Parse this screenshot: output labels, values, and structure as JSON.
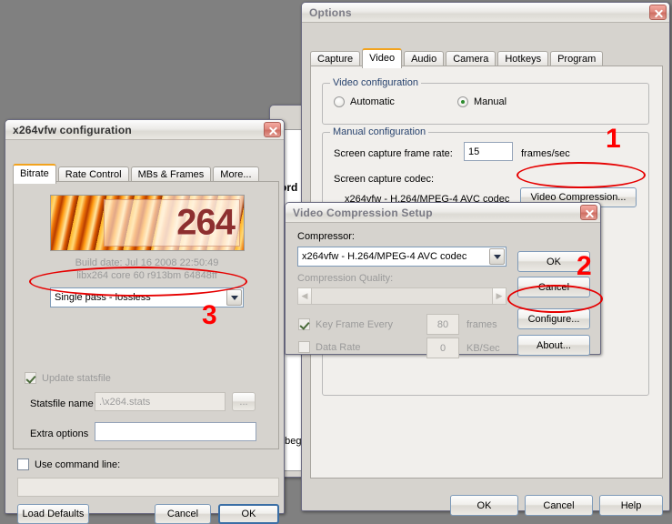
{
  "desktop": {
    "background_color": "#808080"
  },
  "background_window": {
    "fragment_top": "ord",
    "fragment_bottom": "o beg"
  },
  "options_dialog": {
    "title": "Options",
    "tabs": [
      {
        "label": "Capture",
        "active": false
      },
      {
        "label": "Video",
        "active": true
      },
      {
        "label": "Audio",
        "active": false
      },
      {
        "label": "Camera",
        "active": false
      },
      {
        "label": "Hotkeys",
        "active": false
      },
      {
        "label": "Program",
        "active": false
      }
    ],
    "video_configuration": {
      "group_label": "Video configuration",
      "automatic_label": "Automatic",
      "manual_label": "Manual",
      "selected": "Manual"
    },
    "manual_configuration": {
      "group_label": "Manual configuration",
      "frame_rate_label": "Screen capture frame rate:",
      "frame_rate_value": "15",
      "frame_rate_units": "frames/sec",
      "codec_label": "Screen capture codec:",
      "codec_value": "x264vfw - H.264/MPEG-4 AVC codec",
      "video_compression_button": "Video Compression..."
    },
    "footer": {
      "ok": "OK",
      "cancel": "Cancel",
      "help": "Help"
    }
  },
  "video_compression_dialog": {
    "title": "Video Compression Setup",
    "compressor_label": "Compressor:",
    "compressor_value": "x264vfw - H.264/MPEG-4 AVC codec",
    "quality_label": "Compression Quality:",
    "key_frame_label": "Key Frame Every",
    "key_frame_value": "80",
    "key_frame_units": "frames",
    "data_rate_label": "Data Rate",
    "data_rate_value": "0",
    "data_rate_units": "KB/Sec",
    "buttons": {
      "ok": "OK",
      "cancel": "Cancel",
      "configure": "Configure...",
      "about": "About..."
    }
  },
  "x264vfw_dialog": {
    "title": "x264vfw configuration",
    "tabs": [
      {
        "label": "Bitrate",
        "active": true
      },
      {
        "label": "Rate Control",
        "active": false
      },
      {
        "label": "MBs & Frames",
        "active": false
      },
      {
        "label": "More...",
        "active": false
      }
    ],
    "logo_text": "264",
    "build_date": "Build date: Jul 16 2008 22:50:49",
    "core_version": "libx264 core 60 r913bm 64848ff",
    "mode_value": "Single pass - lossless",
    "update_statsfile_label": "Update statsfile",
    "statsfile_name_label": "Statsfile name",
    "statsfile_name_value": ".\\x264.stats",
    "browse_button": "...",
    "extra_options_label": "Extra options",
    "extra_options_value": "",
    "use_command_line_label": "Use command line:",
    "command_line_value": "",
    "buttons": {
      "load_defaults": "Load Defaults",
      "cancel": "Cancel",
      "ok": "OK"
    }
  },
  "annotations": {
    "marker_colour": "#e60000",
    "step_1": "1",
    "step_2": "2",
    "step_3": "3"
  }
}
